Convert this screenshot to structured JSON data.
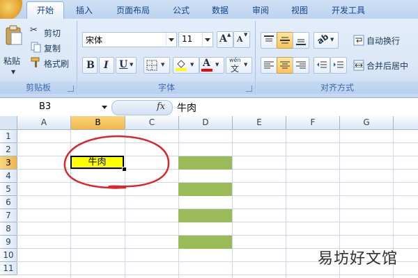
{
  "ribbon_tabs": [
    "开始",
    "插入",
    "页面布局",
    "公式",
    "数据",
    "审阅",
    "视图",
    "开发工具"
  ],
  "clipboard": {
    "paste_label": "粘贴",
    "cut_label": "剪切",
    "copy_label": "复制",
    "format_painter_label": "格式刷",
    "group_label": "剪贴板"
  },
  "font": {
    "font_name": "宋体",
    "font_size": "11",
    "bold": "B",
    "italic": "I",
    "underline": "U",
    "grow": "A",
    "shrink": "A",
    "font_color_glyph": "A",
    "phonetic_glyph": "wén",
    "phonetic_char": "文",
    "group_label": "字体",
    "font_color": "#ff0000",
    "highlight_color": "#ffff00"
  },
  "alignment": {
    "wrap_text_label": "自动换行",
    "merge_center_label": "合并后居中",
    "group_label": "对齐方式"
  },
  "formula_bar": {
    "name_box": "B3",
    "fx": "fx",
    "content": "牛肉"
  },
  "sheet": {
    "columns": [
      "A",
      "B",
      "C",
      "D",
      "E",
      "F",
      "G"
    ],
    "rows": [
      "1",
      "2",
      "3",
      "4",
      "5",
      "6",
      "7",
      "8",
      "9",
      "10",
      "11"
    ],
    "selected_cell": "B3",
    "selected_cell_value": "牛肉",
    "selected_cell_fill": "#ffff00",
    "green_fill": "#9bbb59",
    "green_rows": [
      "3",
      "5",
      "7",
      "9"
    ]
  },
  "annotation_color": "#d9262b",
  "watermark": "易坊好文馆"
}
